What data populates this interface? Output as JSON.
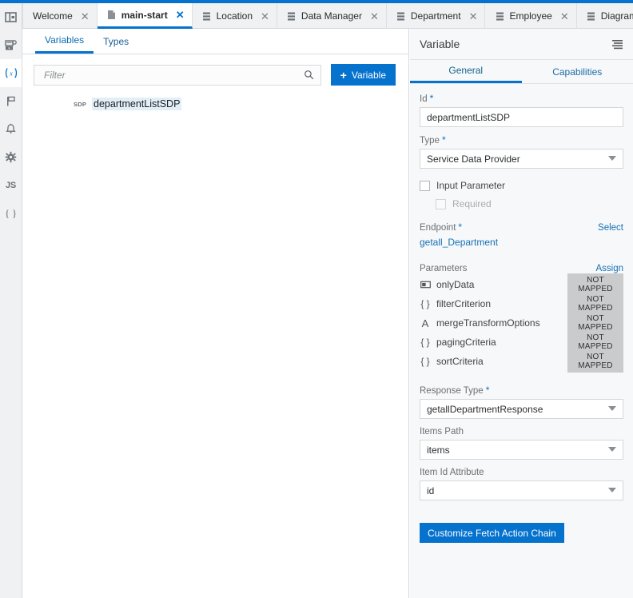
{
  "colors": {
    "accent": "#0572ce",
    "rail_bg": "#eff1f2",
    "panel_bg": "#f7f8f9",
    "badge_bg": "#c9cbcd",
    "link": "#1570b6"
  },
  "rail": {
    "items": [
      {
        "icon": "panel-toggle-icon",
        "selected": false
      },
      {
        "icon": "page-flow-icon",
        "selected": false
      },
      {
        "icon": "variables-icon",
        "label": "(x)",
        "selected": true
      },
      {
        "icon": "flag-icon",
        "selected": false
      },
      {
        "icon": "bell-icon",
        "selected": false
      },
      {
        "icon": "gear-icon",
        "selected": false
      },
      {
        "icon": "javascript-icon",
        "label": "JS",
        "selected": false
      },
      {
        "icon": "json-braces-icon",
        "label": "{ }",
        "selected": false
      }
    ]
  },
  "tabbar": {
    "tabs": [
      {
        "label": "Welcome",
        "icon": "none",
        "active": false,
        "close": "✕"
      },
      {
        "label": "main-start",
        "icon": "page-icon",
        "active": true,
        "close": "✕"
      },
      {
        "label": "Location",
        "icon": "data-icon",
        "active": false,
        "close": "✕"
      },
      {
        "label": "Data Manager",
        "icon": "data-icon",
        "active": false,
        "close": "✕"
      },
      {
        "label": "Department",
        "icon": "data-icon",
        "active": false,
        "close": "✕"
      },
      {
        "label": "Employee",
        "icon": "data-icon",
        "active": false,
        "close": "✕"
      },
      {
        "label": "Diagram",
        "icon": "data-icon",
        "active": false,
        "close": "✕"
      }
    ]
  },
  "left": {
    "subtabs": [
      {
        "label": "Variables",
        "active": true
      },
      {
        "label": "Types",
        "active": false
      }
    ],
    "filter": {
      "value": "",
      "placeholder": "Filter"
    },
    "add_button": {
      "plus": "+",
      "label": "Variable"
    },
    "variables": [
      {
        "badge": "SDP",
        "name": "departmentListSDP",
        "selected": true
      }
    ]
  },
  "right": {
    "title": "Variable",
    "menu_icon": "list-menu-icon",
    "tabs": [
      {
        "label": "General",
        "active": true
      },
      {
        "label": "Capabilities",
        "active": false
      }
    ],
    "id_field": {
      "label": "Id",
      "required": "*",
      "value": "departmentListSDP"
    },
    "type_field": {
      "label": "Type",
      "required": "*",
      "value": "Service Data Provider"
    },
    "input_parameter": {
      "label": "Input Parameter",
      "checked": false
    },
    "required_checkbox": {
      "label": "Required",
      "checked": false,
      "disabled": true
    },
    "endpoint": {
      "label": "Endpoint",
      "required": "*",
      "action_label": "Select",
      "value": "getall_Department"
    },
    "parameters": {
      "label": "Parameters",
      "action_label": "Assign",
      "rows": [
        {
          "icon": "boolean-icon",
          "glyph": "▤",
          "name": "onlyData",
          "status": "NOT MAPPED"
        },
        {
          "icon": "object-braces-icon",
          "glyph": "{ }",
          "name": "filterCriterion",
          "status": "NOT MAPPED"
        },
        {
          "icon": "string-icon",
          "glyph": "A",
          "name": "mergeTransformOptions",
          "status": "NOT MAPPED"
        },
        {
          "icon": "object-braces-icon",
          "glyph": "{ }",
          "name": "pagingCriteria",
          "status": "NOT MAPPED"
        },
        {
          "icon": "object-braces-icon",
          "glyph": "{ }",
          "name": "sortCriteria",
          "status": "NOT MAPPED"
        }
      ]
    },
    "response_type": {
      "label": "Response Type",
      "required": "*",
      "value": "getallDepartmentResponse"
    },
    "items_path": {
      "label": "Items Path",
      "value": "items"
    },
    "item_id_attribute": {
      "label": "Item Id Attribute",
      "value": "id"
    },
    "fetch_button": {
      "label": "Customize Fetch Action Chain"
    }
  }
}
